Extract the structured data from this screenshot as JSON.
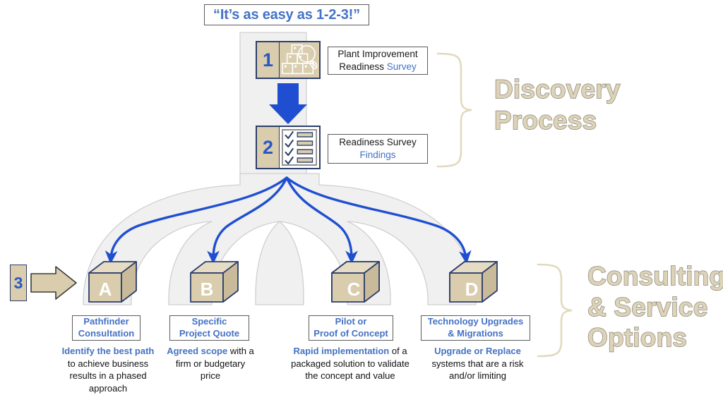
{
  "title": {
    "text": "“It’s as easy as 1-2-3!”"
  },
  "colors": {
    "accent_blue": "#4472c4",
    "arrow_blue": "#2a56c6",
    "tan": "#d9cdae",
    "tan_light": "#ddd3b8",
    "fan_gray": "#f0f0f0",
    "outline_navy": "#2c3e6b",
    "brace_tan": "#e2d9be"
  },
  "discovery": {
    "heading": "Discovery\nProcess",
    "steps": [
      {
        "number": "1",
        "icon": "boxes-magnifier-icon",
        "label_line1": "Plant Improvement",
        "label_line2_plain": "Readiness ",
        "label_line2_highlight": "Survey"
      },
      {
        "number": "2",
        "icon": "checklist-icon",
        "label_line1": "Readiness Survey",
        "label_line2_highlight": "Findings"
      }
    ]
  },
  "consulting": {
    "heading": "Consulting\n& Service\nOptions",
    "step_marker": "3",
    "options": [
      {
        "letter": "A",
        "label_line1": "Pathfinder",
        "label_line2": "Consultation",
        "desc_lead": "Identify the best path",
        "desc_rest": " to achieve business results in a phased approach"
      },
      {
        "letter": "B",
        "label_line1": "Specific",
        "label_line2": "Project Quote",
        "desc_lead": "Agreed scope",
        "desc_rest": " with a firm or budgetary price"
      },
      {
        "letter": "C",
        "label_line1": "Pilot or",
        "label_line2": "Proof of Concept",
        "desc_lead": "Rapid implementation",
        "desc_rest": " of a packaged solution to validate the concept and value"
      },
      {
        "letter": "D",
        "label_line1": "Technology Upgrades",
        "label_line2": "& Migrations",
        "desc_lead": "Upgrade or Replace",
        "desc_rest": " systems that are a risk and/or limiting"
      }
    ]
  }
}
